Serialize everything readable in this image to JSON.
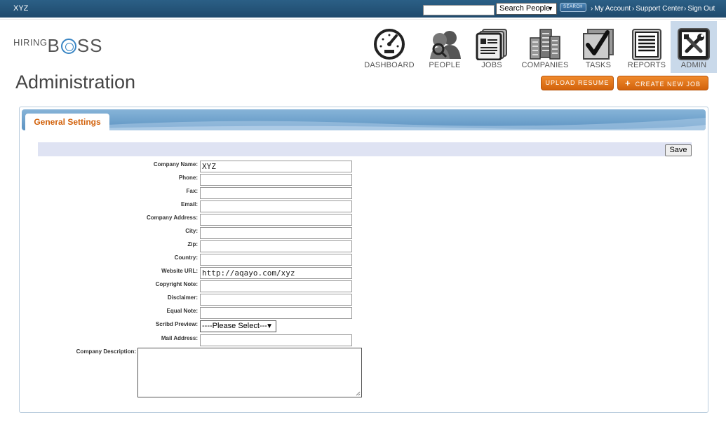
{
  "topbar": {
    "account_name": "XYZ",
    "search_value": "",
    "search_scope": "Search People",
    "search_button": "SEARCH",
    "links": [
      "My Account",
      "Support Center",
      "Sign Out"
    ],
    "link_chevron": "›"
  },
  "logo": {
    "small": "HIRING",
    "big_left": "B",
    "big_right": "SS"
  },
  "nav": [
    {
      "label": "DASHBOARD",
      "icon": "dashboard-icon"
    },
    {
      "label": "PEOPLE",
      "icon": "people-icon"
    },
    {
      "label": "JOBS",
      "icon": "jobs-icon"
    },
    {
      "label": "COMPANIES",
      "icon": "companies-icon"
    },
    {
      "label": "TASKS",
      "icon": "tasks-icon"
    },
    {
      "label": "REPORTS",
      "icon": "reports-icon"
    },
    {
      "label": "ADMIN",
      "icon": "admin-icon",
      "active": true
    }
  ],
  "page": {
    "title": "Administration",
    "upload_resume": "UPLOAD RESUME",
    "create_new_job": "CREATE NEW JOB"
  },
  "panel": {
    "tab": "General Settings",
    "save": "Save"
  },
  "form": {
    "company_name": {
      "label": "Company Name:",
      "value": "XYZ"
    },
    "phone": {
      "label": "Phone:",
      "value": ""
    },
    "fax": {
      "label": "Fax:",
      "value": ""
    },
    "email": {
      "label": "Email:",
      "value": ""
    },
    "company_address": {
      "label": "Company Address:",
      "value": ""
    },
    "city": {
      "label": "City:",
      "value": ""
    },
    "zip": {
      "label": "Zip:",
      "value": ""
    },
    "country": {
      "label": "Country:",
      "value": ""
    },
    "website_url": {
      "label": "Website URL:",
      "value": "http://aqayo.com/xyz"
    },
    "copyright_note": {
      "label": "Copyright Note:",
      "value": ""
    },
    "disclaimer": {
      "label": "Disclaimer:",
      "value": ""
    },
    "equal_note": {
      "label": "Equal Note:",
      "value": ""
    },
    "scribd_preview": {
      "label": "Scribd Preview:",
      "value": "----Please Select---"
    },
    "mail_address": {
      "label": "Mail Address:",
      "value": ""
    },
    "company_description": {
      "label": "Company Description:",
      "value": ""
    }
  },
  "colors": {
    "topbar": "#1f4a6d",
    "accent_orange": "#d2620c",
    "panel_header": "#5c93c2",
    "active_nav": "#c9d9ea"
  }
}
